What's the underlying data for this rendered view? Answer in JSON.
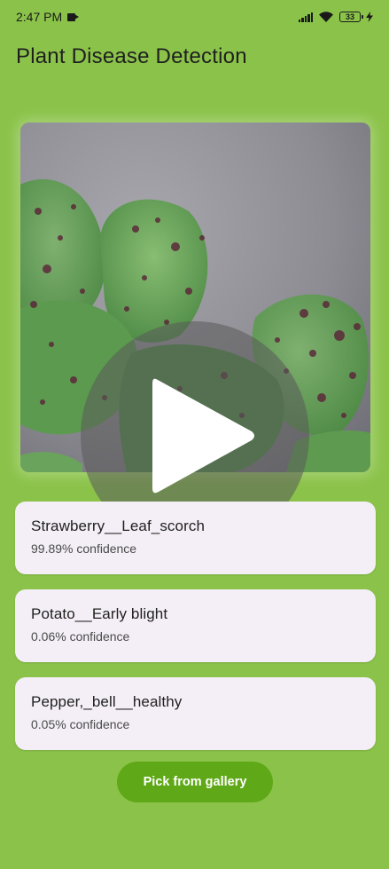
{
  "status_bar": {
    "time": "2:47 PM",
    "battery": "33",
    "icons": [
      "video-camera-icon",
      "signal-icon",
      "wifi-icon",
      "battery-icon",
      "charging-icon"
    ]
  },
  "app": {
    "title": "Plant Disease Detection"
  },
  "image_preview": {
    "overlay_icon": "play-icon"
  },
  "results": [
    {
      "label": "Strawberry__Leaf_scorch",
      "confidence": "99.89% confidence"
    },
    {
      "label": "Potato__Early blight",
      "confidence": "0.06% confidence"
    },
    {
      "label": "Pepper,_bell__healthy",
      "confidence": "0.05% confidence"
    }
  ],
  "actions": {
    "pick_label": "Pick from gallery"
  },
  "colors": {
    "background": "#8bc34a",
    "card": "#f4eff6",
    "button": "#5fa817"
  }
}
